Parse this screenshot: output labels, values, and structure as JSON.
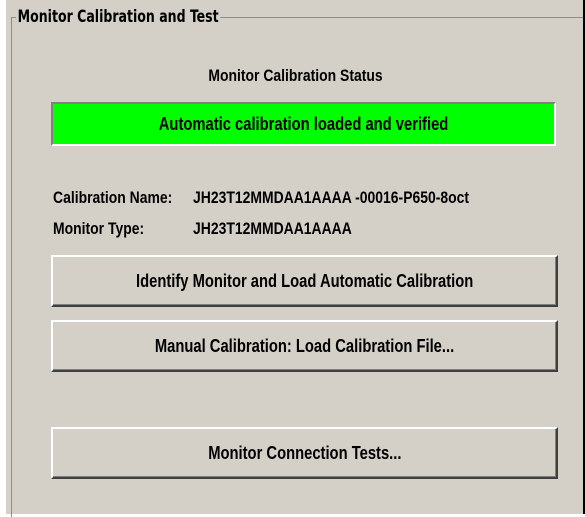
{
  "group": {
    "title": "Monitor Calibration and Test"
  },
  "status": {
    "heading": "Monitor Calibration Status",
    "message": "Automatic calibration loaded and verified",
    "color": "#00ff00"
  },
  "info": {
    "calibration_name_label": "Calibration Name:",
    "calibration_name_value": "JH23T12MMDAA1AAAA -00016-P650-8oct",
    "monitor_type_label": "Monitor Type:",
    "monitor_type_value": "JH23T12MMDAA1AAAA"
  },
  "buttons": {
    "identify": "Identify Monitor and Load Automatic Calibration",
    "manual": "Manual Calibration: Load Calibration File...",
    "connection_tests": "Monitor Connection Tests..."
  }
}
